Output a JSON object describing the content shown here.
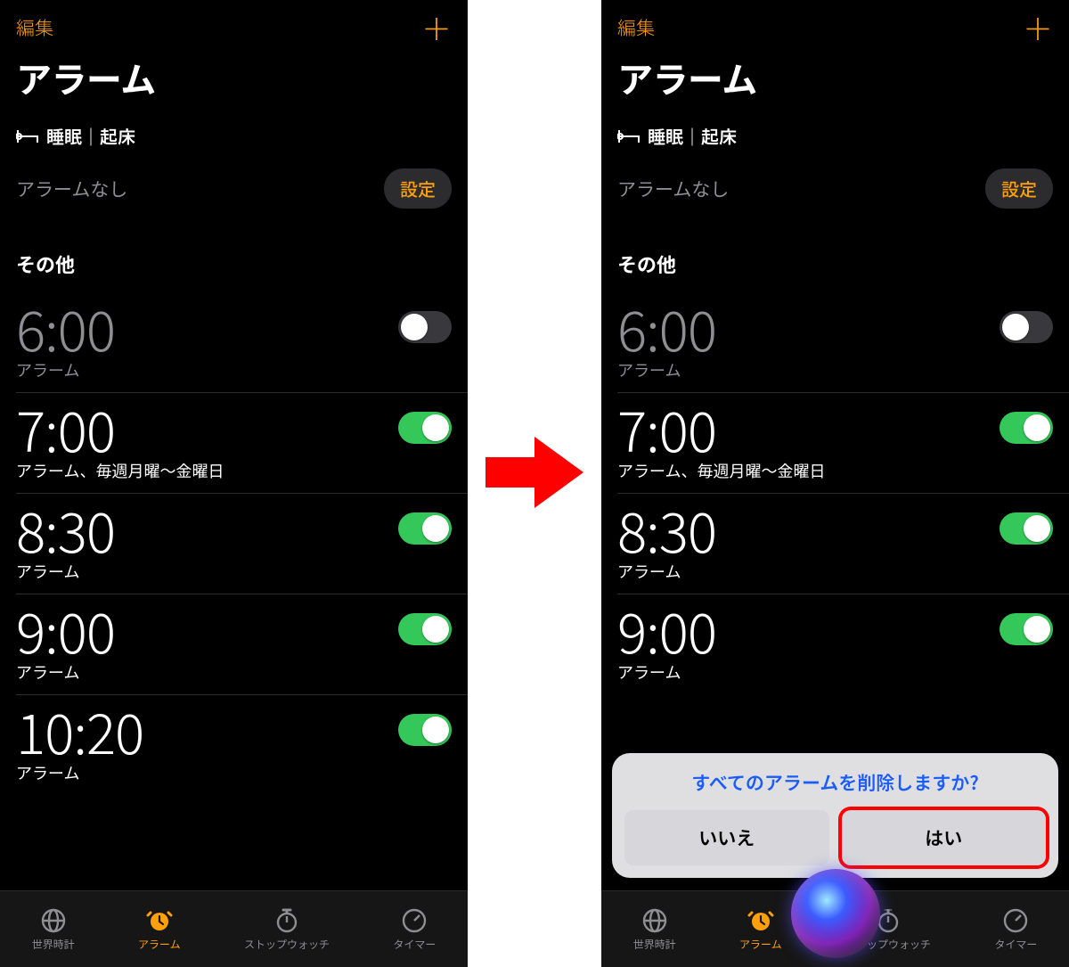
{
  "colors": {
    "accent": "#ff9f0a",
    "switch_on": "#34c759",
    "siri_blue": "#1a5cff"
  },
  "header": {
    "edit": "編集",
    "title": "アラーム"
  },
  "sleep": {
    "heading": "睡眠｜起床",
    "no_alarm": "アラームなし",
    "config": "設定"
  },
  "others": {
    "heading": "その他"
  },
  "alarms": [
    {
      "time": "6:00",
      "label": "アラーム",
      "enabled": false
    },
    {
      "time": "7:00",
      "label": "アラーム、毎週月曜〜金曜日",
      "enabled": true
    },
    {
      "time": "8:30",
      "label": "アラーム",
      "enabled": true
    },
    {
      "time": "9:00",
      "label": "アラーム",
      "enabled": true
    },
    {
      "time": "10:20",
      "label": "アラーム",
      "enabled": true
    }
  ],
  "tabs": {
    "world": "世界時計",
    "alarm": "アラーム",
    "stopwatch": "ストップウォッチ",
    "timer": "タイマー"
  },
  "siri": {
    "question": "すべてのアラームを削除しますか?",
    "no": "いいえ",
    "yes": "はい"
  },
  "icons": {
    "plus": "＋"
  }
}
